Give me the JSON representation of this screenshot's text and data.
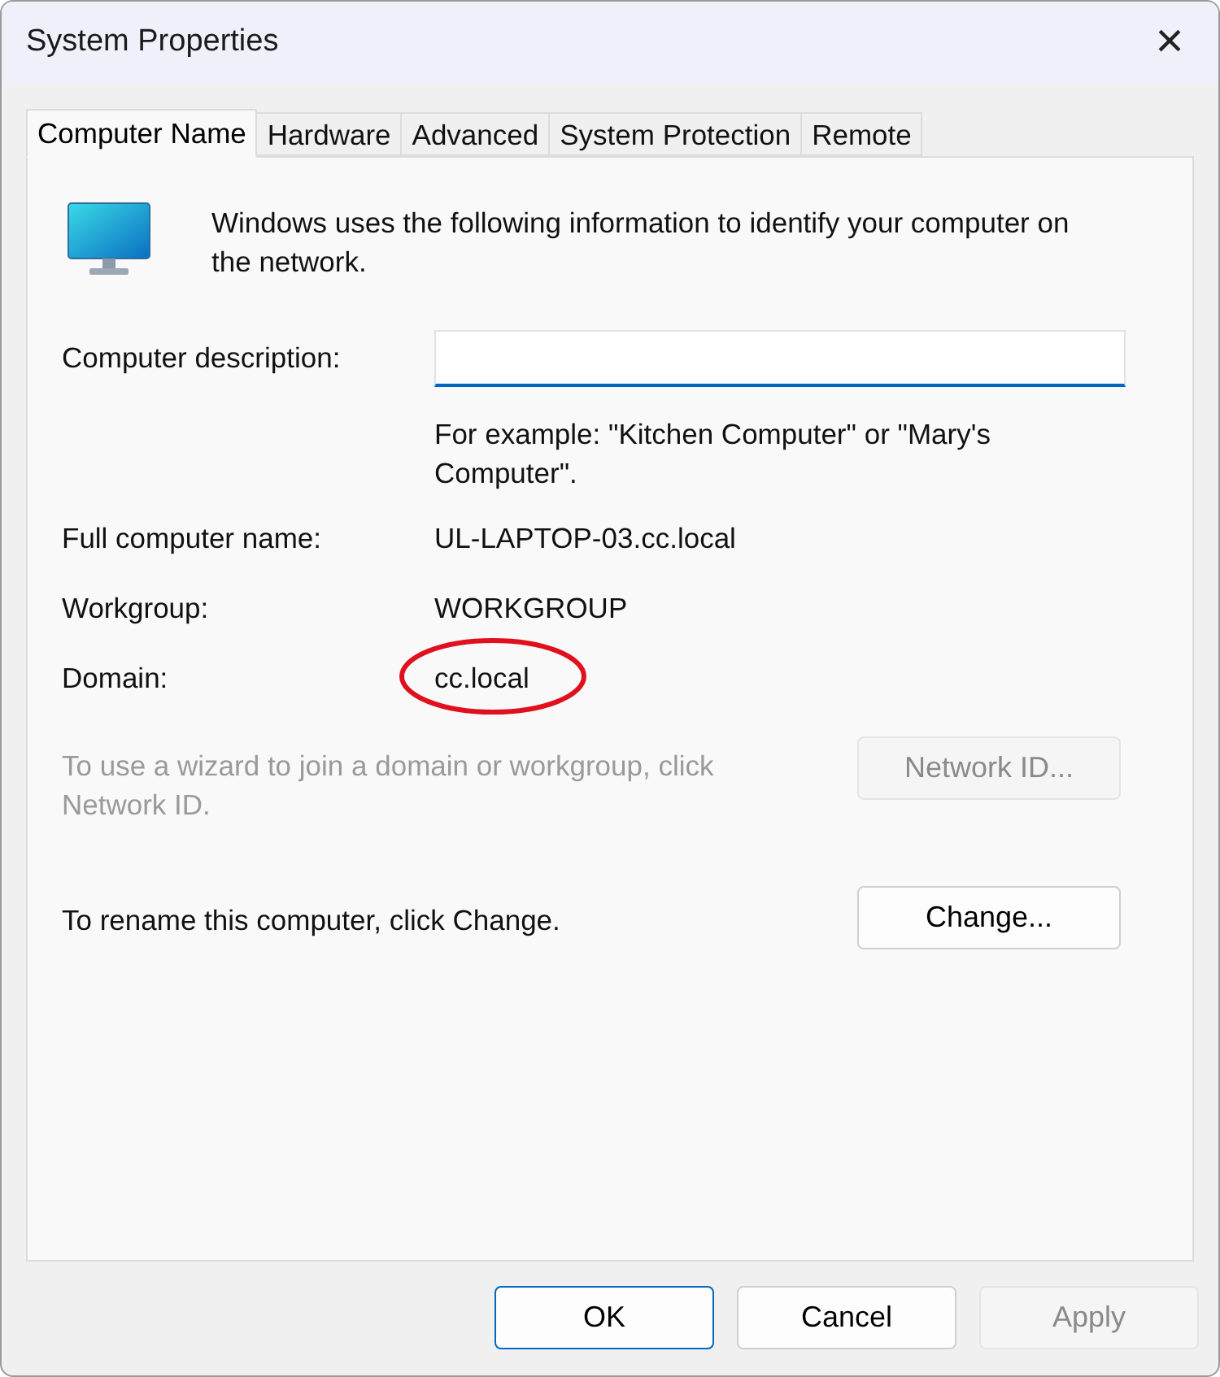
{
  "window": {
    "title": "System Properties",
    "close": "×"
  },
  "tabs": [
    {
      "label": "Computer Name",
      "selected": true
    },
    {
      "label": "Hardware",
      "selected": false
    },
    {
      "label": "Advanced",
      "selected": false
    },
    {
      "label": "System Protection",
      "selected": false
    },
    {
      "label": "Remote",
      "selected": false
    }
  ],
  "intro": "Windows uses the following information to identify your computer on the network.",
  "description": {
    "label": "Computer description:",
    "hint": "For example: \"Kitchen Computer\" or \"Mary's Computer\"."
  },
  "info": [
    {
      "label": "Full computer name:",
      "value": "UL-LAPTOP-03.cc.local",
      "circled": false
    },
    {
      "label": "Workgroup:",
      "value": "WORKGROUP",
      "circled": false
    },
    {
      "label": "Domain:",
      "value": "cc.local",
      "circled": true
    }
  ],
  "network_id": {
    "text": "To use a wizard to join a domain or workgroup, click Network ID.",
    "button": "Network ID...",
    "disabled": true
  },
  "rename": {
    "text": "To rename this computer, click Change.",
    "button": "Change...",
    "disabled": false
  },
  "buttons": [
    {
      "label": "OK",
      "default": true,
      "disabled": false
    },
    {
      "label": "Cancel",
      "default": false,
      "disabled": false
    },
    {
      "label": "Apply",
      "default": false,
      "disabled": true
    }
  ]
}
